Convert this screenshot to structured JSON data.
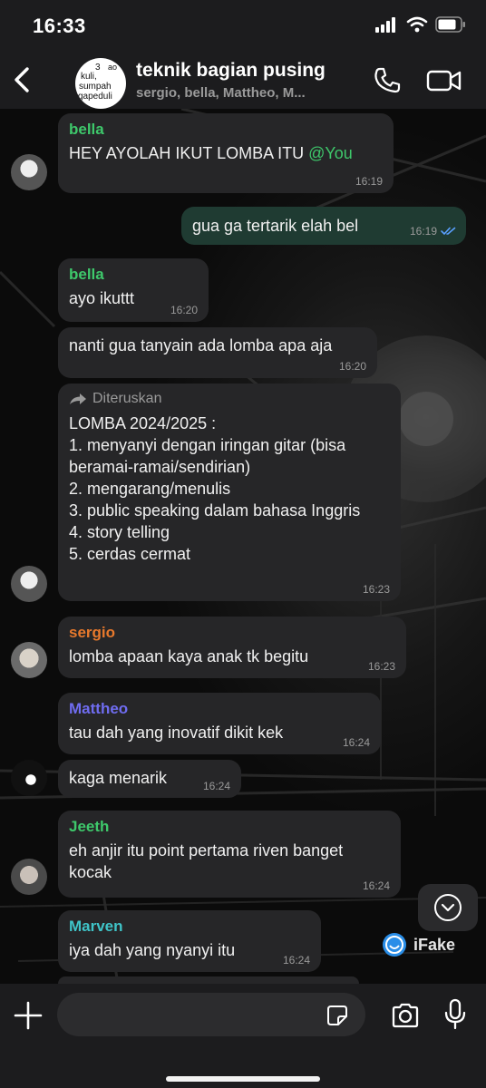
{
  "status_bar": {
    "time": "16:33"
  },
  "header": {
    "title": "teknik bagian pusing",
    "subtitle": "sergio, bella, Mattheo, M...",
    "avatar_lines": [
      "3",
      "ao",
      "kuli,",
      "sumpah",
      "gapeduli"
    ]
  },
  "messages": [
    {
      "sender": "bella",
      "sender_color": "#3ec86b",
      "text": "HEY AYOLAH IKUT LOMBA ITU ",
      "mention": "@You",
      "time": "16:19"
    },
    {
      "text": "gua ga tertarik elah bel",
      "time": "16:19",
      "outgoing": true
    },
    {
      "sender": "bella",
      "sender_color": "#3ec86b",
      "text": "ayo ikuttt",
      "time": "16:20"
    },
    {
      "text": "nanti gua tanyain ada lomba apa aja",
      "time": "16:20"
    },
    {
      "forwarded_label": "Diteruskan",
      "text": "LOMBA 2024/2025 :\n1. menyanyi dengan iringan gitar (bisa beramai-ramai/sendirian)\n2. mengarang/menulis\n3. public speaking dalam bahasa Inggris\n4. story telling\n5. cerdas cermat",
      "time": "16:23"
    },
    {
      "sender": "sergio",
      "sender_color": "#e8792c",
      "text": "lomba apaan kaya anak tk begitu",
      "time": "16:23"
    },
    {
      "sender": "Mattheo",
      "sender_color": "#6f6cf0",
      "text": "tau dah yang inovatif dikit kek",
      "time": "16:24"
    },
    {
      "text": "kaga menarik",
      "time": "16:24"
    },
    {
      "sender": "Jeeth",
      "sender_color": "#3ec86b",
      "text": "eh anjir itu point pertama riven banget kocak",
      "time": "16:24"
    },
    {
      "sender": "Marven",
      "sender_color": "#3fc4c8",
      "text": "iya dah yang nyanyi itu",
      "time": "16:24"
    }
  ],
  "watermark": "iFake",
  "input": {
    "placeholder": ""
  },
  "colors": {
    "bar_bg": "#1c1c1e",
    "bubble_in": "#262628",
    "bubble_out": "#1f3b32",
    "read_ticks": "#5aa0ff"
  }
}
